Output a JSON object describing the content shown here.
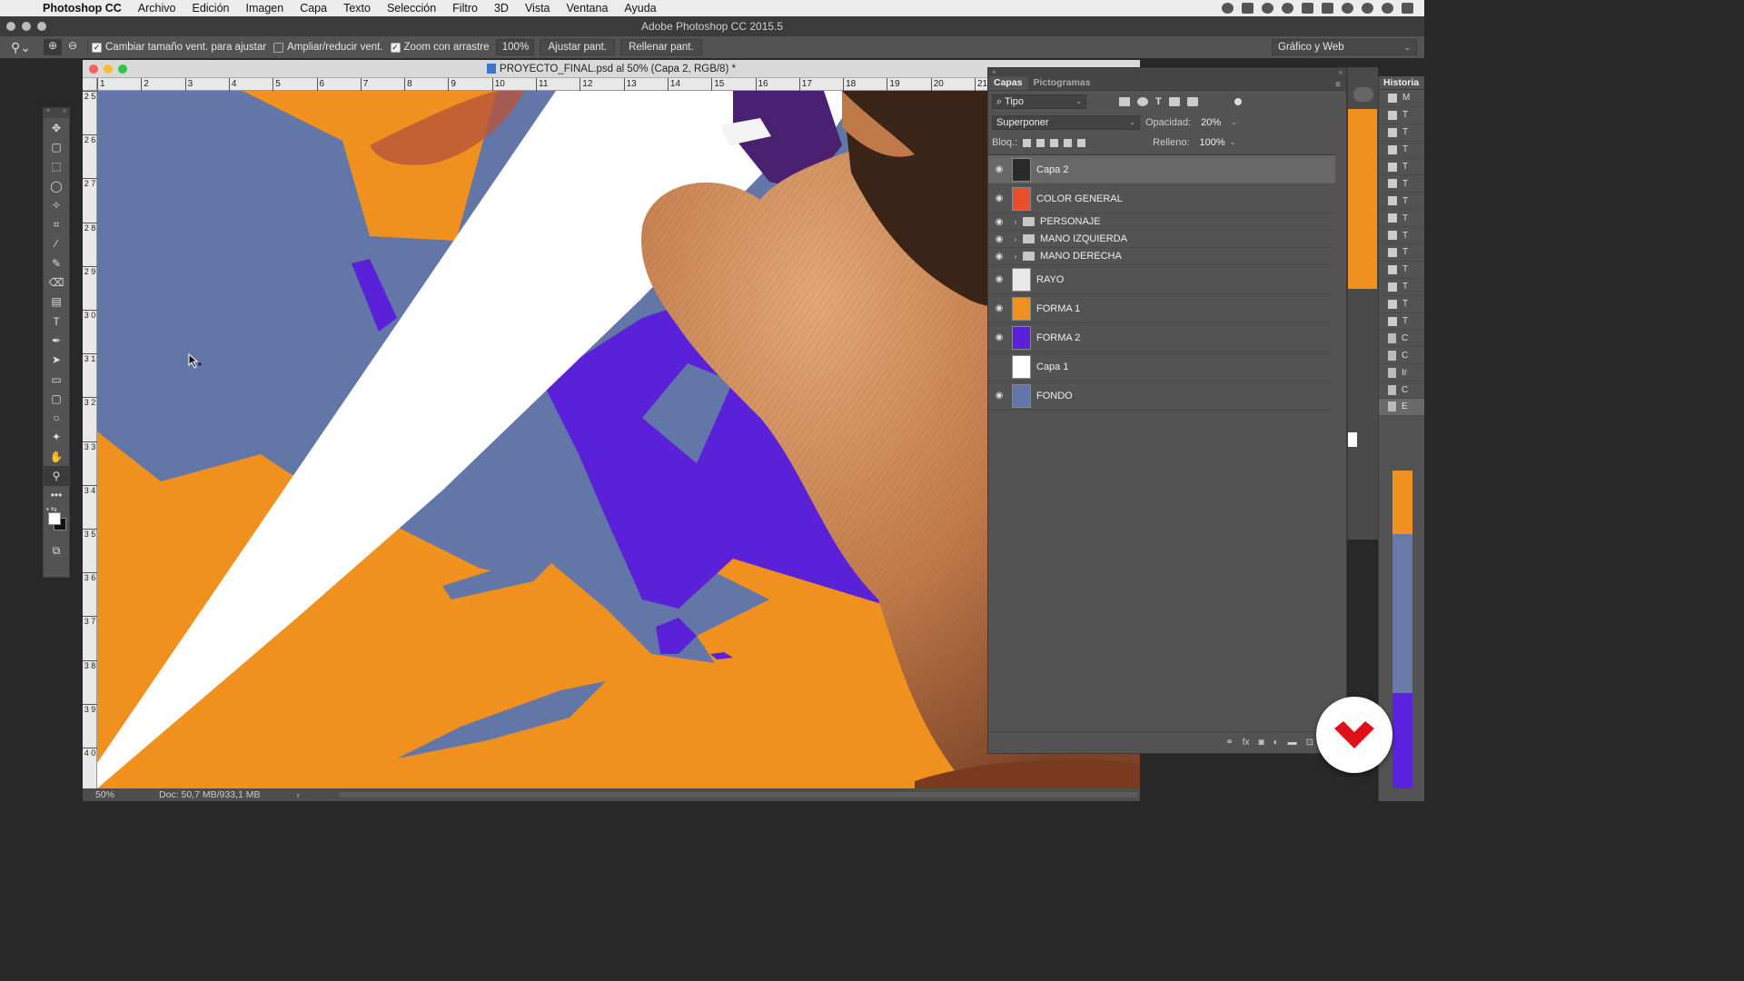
{
  "menubar": {
    "app_name": "Photoshop CC",
    "items": [
      "Archivo",
      "Edición",
      "Imagen",
      "Capa",
      "Texto",
      "Selección",
      "Filtro",
      "3D",
      "Vista",
      "Ventana",
      "Ayuda"
    ]
  },
  "app_title": "Adobe Photoshop CC 2015.5",
  "options_bar": {
    "resize_windows_label": "Cambiar tamaño vent. para ajustar",
    "zoom_all_windows_label": "Ampliar/reducir vent.",
    "scrubby_zoom_label": "Zoom con arrastre",
    "zoom_value": "100%",
    "fit_screen_label": "Ajustar pant.",
    "fill_screen_label": "Rellenar pant.",
    "workspace": "Gráfico y Web"
  },
  "document": {
    "tab_title": "PROYECTO_FINAL.psd al 50% (Capa 2, RGB/8) *",
    "zoom": "50%",
    "doc_info": "Doc: 50,7 MB/933,1 MB",
    "h_ruler": [
      "1",
      "2",
      "3",
      "4",
      "5",
      "6",
      "7",
      "8",
      "9",
      "10",
      "11",
      "12",
      "13",
      "14",
      "15",
      "16",
      "17",
      "18",
      "19",
      "20",
      "21"
    ],
    "v_ruler": [
      "2 5",
      "2 6",
      "2 7",
      "2 8",
      "2 9",
      "3 0",
      "3 1",
      "3 2",
      "3 3",
      "3 4",
      "3 5",
      "3 6",
      "3 7",
      "3 8",
      "3 9",
      "4 0"
    ]
  },
  "layers_panel": {
    "tabs": [
      "Capas",
      "Pictogramas"
    ],
    "filter_kind": "Tipo",
    "blend_mode": "Superponer",
    "opacity_label": "Opacidad:",
    "opacity": "20%",
    "lock_label": "Bloq.:",
    "fill_label": "Relleno:",
    "fill": "100%",
    "layers": [
      {
        "name": "Capa 2",
        "visible": true,
        "selected": true,
        "group": false,
        "thumb_color": "#2a2a2a"
      },
      {
        "name": "COLOR GENERAL",
        "visible": true,
        "selected": false,
        "group": false,
        "thumb_color": "#e8502a"
      },
      {
        "name": "PERSONAJE",
        "visible": true,
        "selected": false,
        "group": true
      },
      {
        "name": "MANO IZQUIERDA",
        "visible": true,
        "selected": false,
        "group": true
      },
      {
        "name": "MANO DERECHA",
        "visible": true,
        "selected": false,
        "group": true
      },
      {
        "name": "RAYO",
        "visible": true,
        "selected": false,
        "group": false,
        "thumb_color": "#e8e8e8"
      },
      {
        "name": "FORMA 1",
        "visible": true,
        "selected": false,
        "group": false,
        "thumb_color": "#f0901f"
      },
      {
        "name": "FORMA 2",
        "visible": true,
        "selected": false,
        "group": false,
        "thumb_color": "#5b21d9"
      },
      {
        "name": "Capa 1",
        "visible": false,
        "selected": false,
        "group": false,
        "thumb_color": "#ffffff"
      },
      {
        "name": "FONDO",
        "visible": true,
        "selected": false,
        "group": false,
        "thumb_color": "#6276a8"
      }
    ]
  },
  "history_panel": {
    "title": "Historia",
    "items": [
      "M",
      "T",
      "T",
      "T",
      "T",
      "T",
      "T",
      "T",
      "T",
      "T",
      "T",
      "T",
      "T",
      "T",
      "C",
      "C",
      "Ir",
      "C",
      "E"
    ]
  },
  "colors": {
    "canvas_blue": "#6276a8",
    "orange": "#f0901f",
    "purple": "#5b21d9",
    "skin": "#c8875a",
    "logo_red": "#e0101a"
  }
}
